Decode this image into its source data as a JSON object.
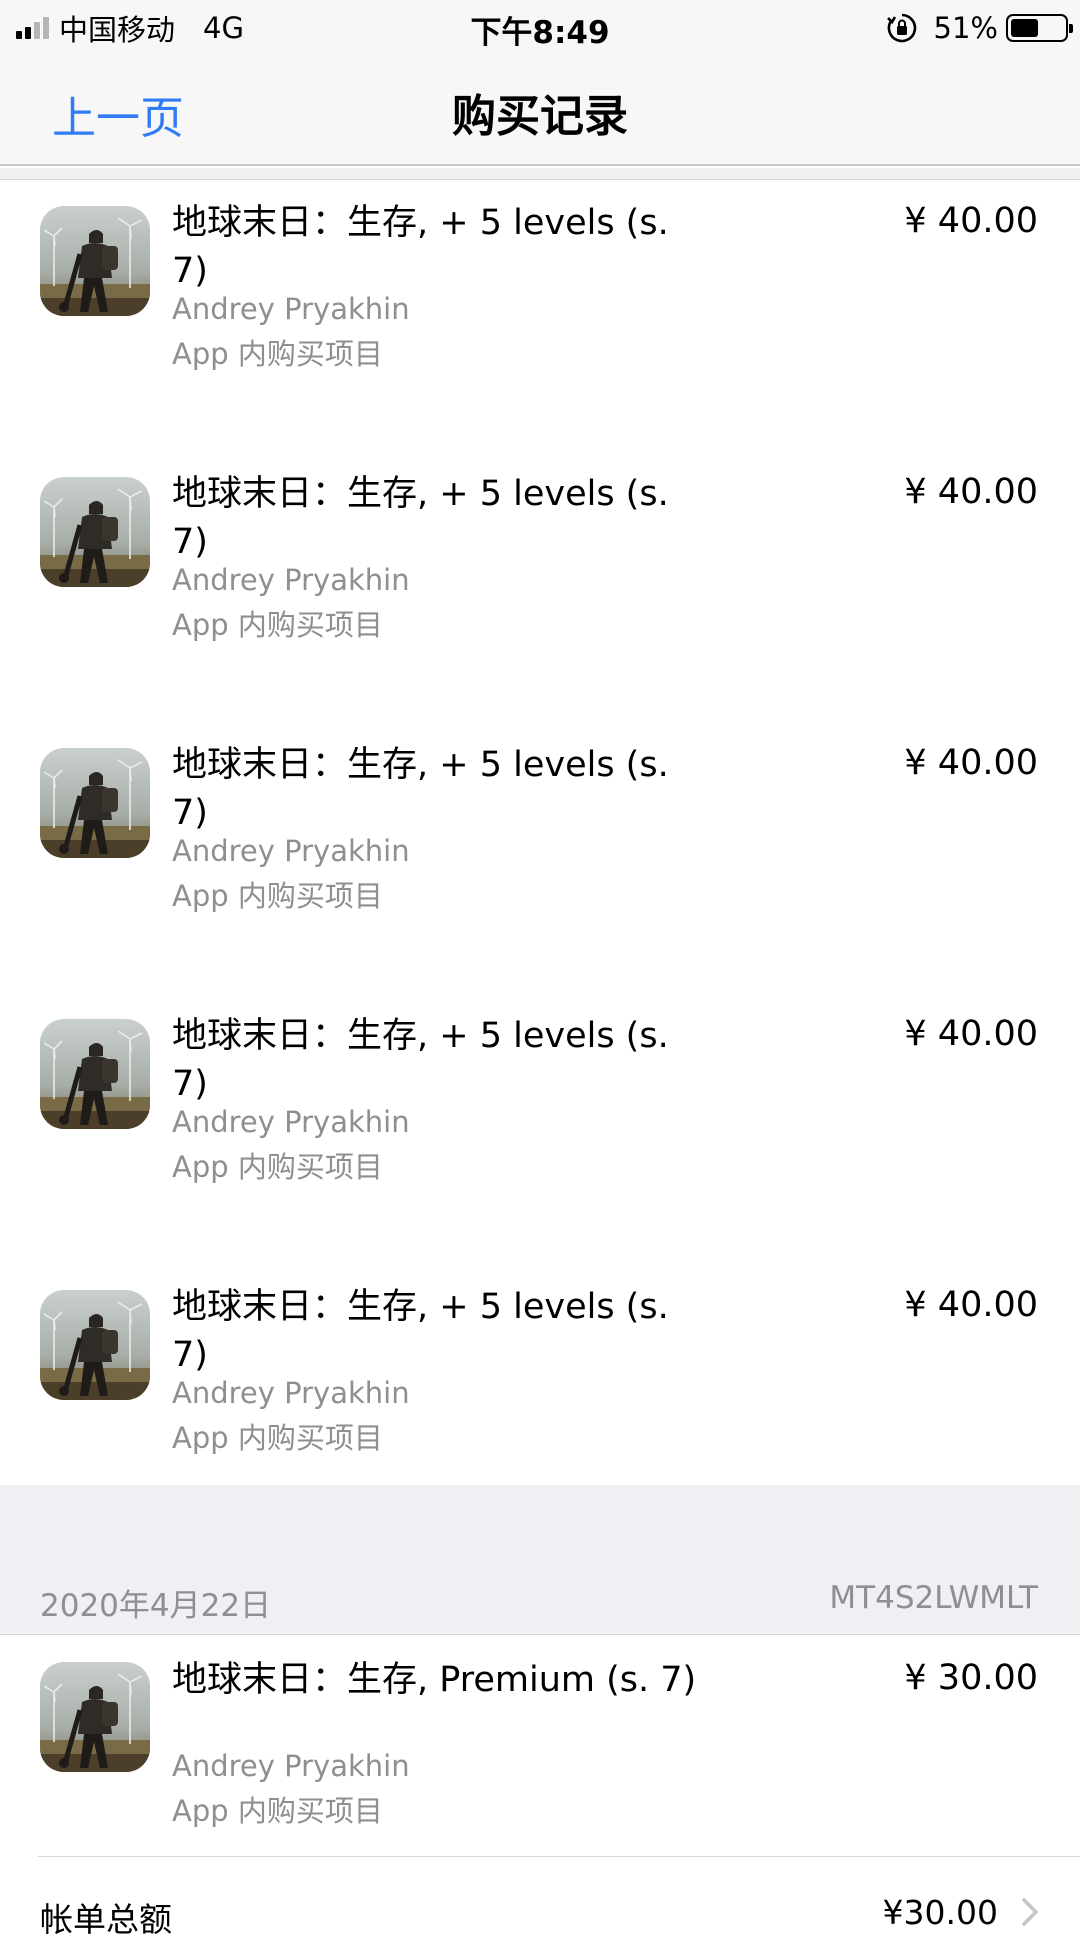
{
  "status_bar": {
    "carrier": "中国移动",
    "network": "4G",
    "time": "下午8:49",
    "battery_percent": "51%",
    "battery_level": 0.51
  },
  "nav": {
    "back_label": "上一页",
    "title": "购买记录"
  },
  "purchases": [
    {
      "title": "地球末日：生存, + 5 levels (s. 7)",
      "developer": "Andrey Pryakhin",
      "type": "App 内购买项目",
      "price": "¥ 40.00",
      "icon": "game-app-icon"
    },
    {
      "title": "地球末日：生存, + 5 levels (s. 7)",
      "developer": "Andrey Pryakhin",
      "type": "App 内购买项目",
      "price": "¥ 40.00",
      "icon": "game-app-icon"
    },
    {
      "title": "地球末日：生存, + 5 levels (s. 7)",
      "developer": "Andrey Pryakhin",
      "type": "App 内购买项目",
      "price": "¥ 40.00",
      "icon": "game-app-icon"
    },
    {
      "title": "地球末日：生存, + 5 levels (s. 7)",
      "developer": "Andrey Pryakhin",
      "type": "App 内购买项目",
      "price": "¥ 40.00",
      "icon": "game-app-icon"
    },
    {
      "title": "地球末日：生存, + 5 levels (s. 7)",
      "developer": "Andrey Pryakhin",
      "type": "App 内购买项目",
      "price": "¥ 40.00",
      "icon": "game-app-icon"
    }
  ],
  "section": {
    "date": "2020年4月22日",
    "order_id": "MT4S2LWMLT",
    "item": {
      "title": "地球末日：生存, Premium (s. 7)",
      "developer": "Andrey Pryakhin",
      "type": "App 内购买项目",
      "price": "¥ 30.00",
      "icon": "game-app-icon"
    },
    "total_label": "帐单总额",
    "total_amount": "¥30.00"
  },
  "colors": {
    "accent": "#2f7cf6",
    "secondary_text": "#8e8e93",
    "group_background": "#efeff4"
  }
}
